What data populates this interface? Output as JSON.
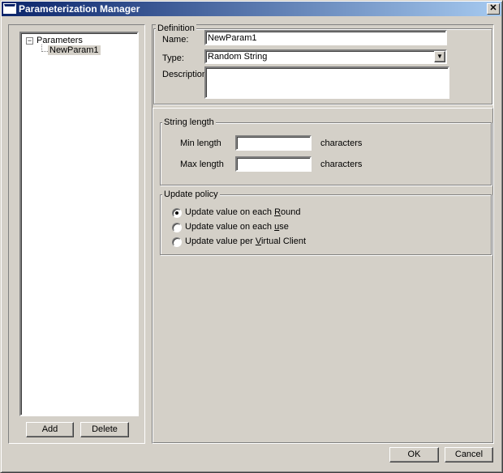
{
  "window": {
    "title": "Parameterization Manager",
    "close": "✕"
  },
  "tree": {
    "root": "Parameters",
    "expander": "−",
    "children": [
      "NewParam1"
    ]
  },
  "left_buttons": {
    "add": "Add",
    "delete": "Delete"
  },
  "definition": {
    "legend": "Definition",
    "name_label": "Name:",
    "name_value": "NewParam1",
    "type_label": "Type:",
    "type_value": "Random String",
    "description_label": "Description",
    "description_value": ""
  },
  "string_length": {
    "legend": "String length",
    "min_label": "Min length",
    "min_value": "",
    "max_label": "Max length",
    "max_value": "",
    "unit": "characters"
  },
  "update_policy": {
    "legend": "Update policy",
    "selected": 0,
    "options": [
      {
        "pre": "Update value on each ",
        "key": "R",
        "post": "ound"
      },
      {
        "pre": "Update value on each ",
        "key": "u",
        "post": "se"
      },
      {
        "pre": "Update value per ",
        "key": "V",
        "post": "irtual Client"
      }
    ]
  },
  "footer": {
    "ok": "OK",
    "cancel": "Cancel"
  }
}
